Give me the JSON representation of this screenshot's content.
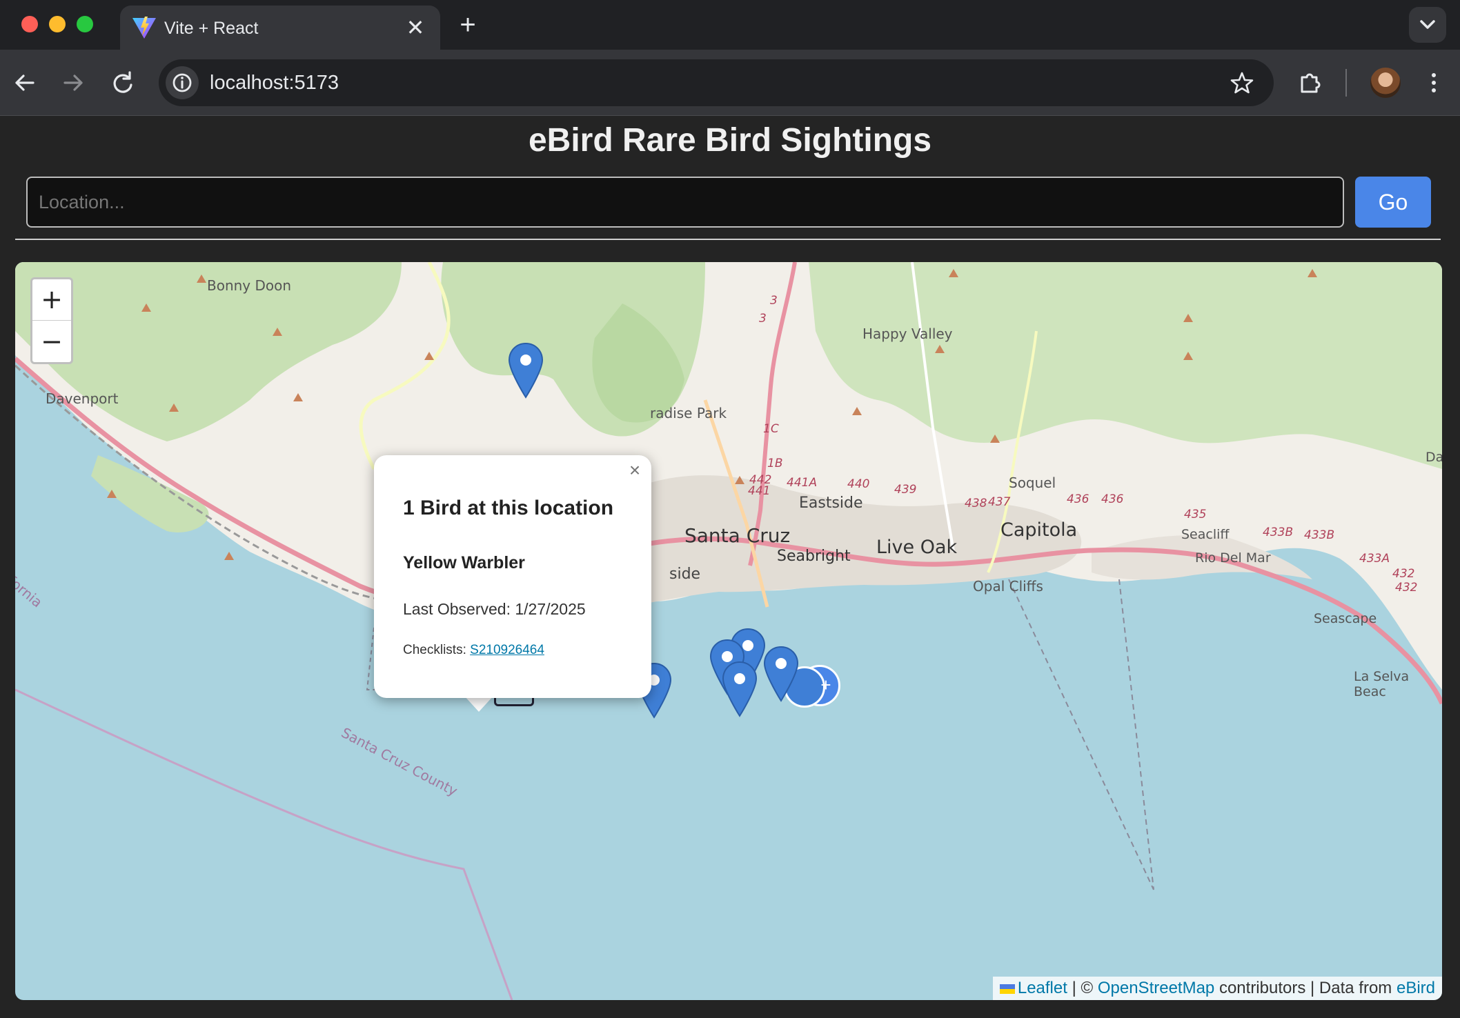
{
  "browser": {
    "tab_title": "Vite + React",
    "new_tab_symbol": "+",
    "url": "localhost:5173"
  },
  "header": {
    "title": "eBird Rare Bird Sightings"
  },
  "search": {
    "placeholder": "Location...",
    "value": "",
    "go_label": "Go"
  },
  "map": {
    "zoom_in": "+",
    "zoom_out": "−",
    "place_labels": [
      "Bonny Doon",
      "Happy Valley",
      "Davenport",
      "radise Park",
      "Eastside",
      "Soquel",
      "Santa Cruz",
      "Live Oak",
      "Capitola",
      "Seabright",
      "Seacliff",
      "Rio Del Mar",
      "Opal Cliffs",
      "Seascape",
      "La Selva Beac",
      "Santa Cruz County",
      "fornia",
      "side",
      "Da"
    ],
    "road_labels": [
      "1C",
      "1B",
      "442",
      "441",
      "441A",
      "440",
      "439",
      "438",
      "437",
      "436",
      "436",
      "435",
      "433B",
      "433B",
      "433A",
      "432",
      "432",
      "3",
      "3"
    ],
    "cluster_symbol": "+",
    "popup": {
      "close": "×",
      "title": "1 Bird at this location",
      "species": "Yellow Warbler",
      "last_observed_label": "Last Observed:",
      "last_observed_date": "1/27/2025",
      "checklists_label": "Checklists:",
      "checklist_id": "S210926464"
    },
    "attribution": {
      "leaflet": "Leaflet",
      "sep1": "|",
      "copyright": "©",
      "osm": "OpenStreetMap",
      "contributors": "contributors",
      "sep2": "|",
      "data_from": "Data from",
      "ebird": "eBird"
    }
  },
  "colors": {
    "accent": "#4a86e8",
    "marker": "#3f7fd6",
    "water": "#aad3df",
    "land": "#f2efe9",
    "forest": "#c8e0b4"
  }
}
